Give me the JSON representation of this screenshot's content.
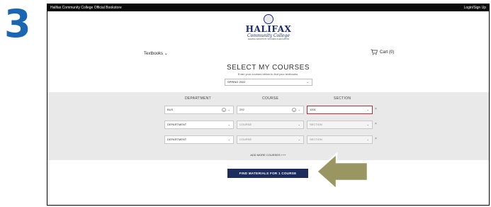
{
  "step_number": "3",
  "topbar": {
    "brand": "Halifax Community College Official Bookstore",
    "login": "Login/Sign Up"
  },
  "logo": {
    "name": "HALIFAX",
    "script": "Community College",
    "tagline": "LEADING GROWTH BY SUCCESS IN EDUCATION"
  },
  "nav": {
    "textbooks": "Textbooks",
    "cart": "Cart (0)"
  },
  "selector": {
    "title": "SELECT MY COURSES",
    "subtitle": "Enter your courses below to find your textbooks.",
    "term": "SPRING 2022"
  },
  "columns": {
    "department": "DEPARTMENT",
    "course": "COURSE",
    "section": "SECTION"
  },
  "rows": [
    {
      "department": "BUS",
      "course": "292",
      "section": "1001"
    },
    {
      "department": "DEPARTMENT",
      "course": "COURSE",
      "section": "SECTION"
    },
    {
      "department": "DEPARTMENT",
      "course": "COURSE",
      "section": "SECTION"
    }
  ],
  "remove_label": "×",
  "add_more": "ADD MORE COURSES +++",
  "find_button": "FIND MATERIALS FOR 1 COURSE",
  "colors": {
    "step": "#1b66b3",
    "button": "#1c2c5e",
    "arrow": "#9a9662",
    "accent_red": "#b42b3a"
  }
}
